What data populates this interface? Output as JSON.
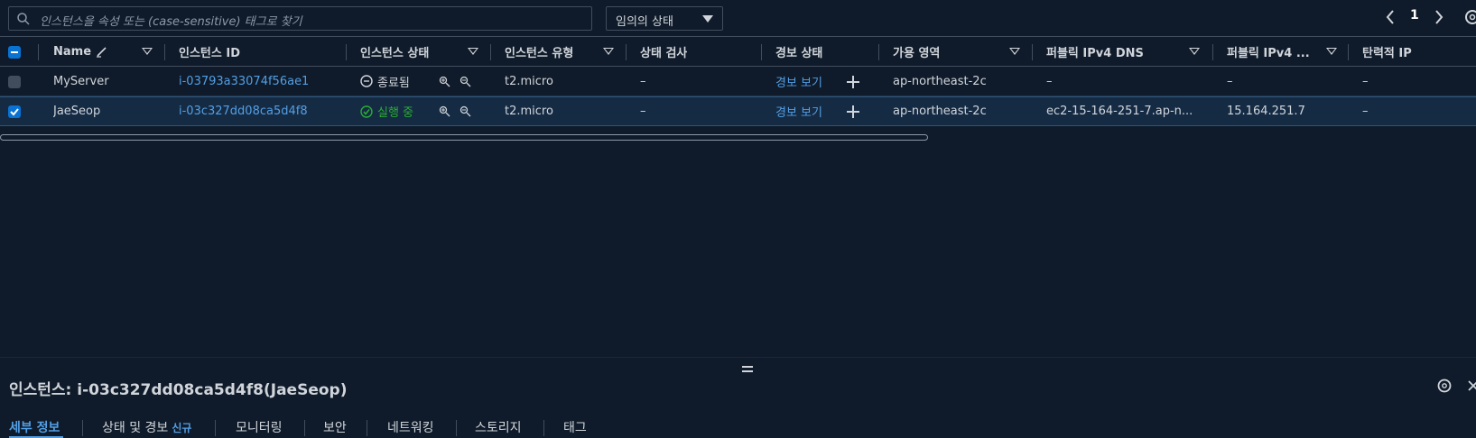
{
  "search": {
    "placeholder": "인스턴스을 속성 또는 (case-sensitive) 태그로 찾기"
  },
  "state_filter": {
    "value": "임의의 상태"
  },
  "pager": {
    "page": "1"
  },
  "columns": {
    "name": "Name",
    "instance_id": "인스턴스 ID",
    "instance_state": "인스턴스 상태",
    "instance_type": "인스턴스 유형",
    "status_check": "상태 검사",
    "alarm_status": "경보 상태",
    "az": "가용 영역",
    "public_dns": "퍼블릭 IPv4 DNS",
    "public_ip": "퍼블릭 IPv4 ...",
    "elastic_ip": "탄력적 IP"
  },
  "rows": [
    {
      "name": "MyServer",
      "instance_id": "i-03793a33074f56ae1",
      "state": "종료됨",
      "type": "t2.micro",
      "status_check": "–",
      "alarm": "경보 보기",
      "az": "ap-northeast-2c",
      "dns": "–",
      "ip": "–",
      "eip": "–"
    },
    {
      "name": "JaeSeop",
      "instance_id": "i-03c327dd08ca5d4f8",
      "state": "실행 중",
      "type": "t2.micro",
      "status_check": "–",
      "alarm": "경보 보기",
      "az": "ap-northeast-2c",
      "dns": "ec2-15-164-251-7.ap-n...",
      "ip": "15.164.251.7",
      "eip": "–"
    }
  ],
  "detail": {
    "title": "인스턴스: i-03c327dd08ca5d4f8(JaeSeop)"
  },
  "tabs": [
    {
      "label": "세부 정보"
    },
    {
      "label": "상태 및 경보",
      "badge": "신규"
    },
    {
      "label": "모니터링"
    },
    {
      "label": "보안"
    },
    {
      "label": "네트워킹"
    },
    {
      "label": "스토리지"
    },
    {
      "label": "태그"
    }
  ],
  "colors": {
    "background": "#0f1b2a",
    "link": "#539fe5",
    "running": "#29ad32",
    "selected_row": "#152b44"
  }
}
